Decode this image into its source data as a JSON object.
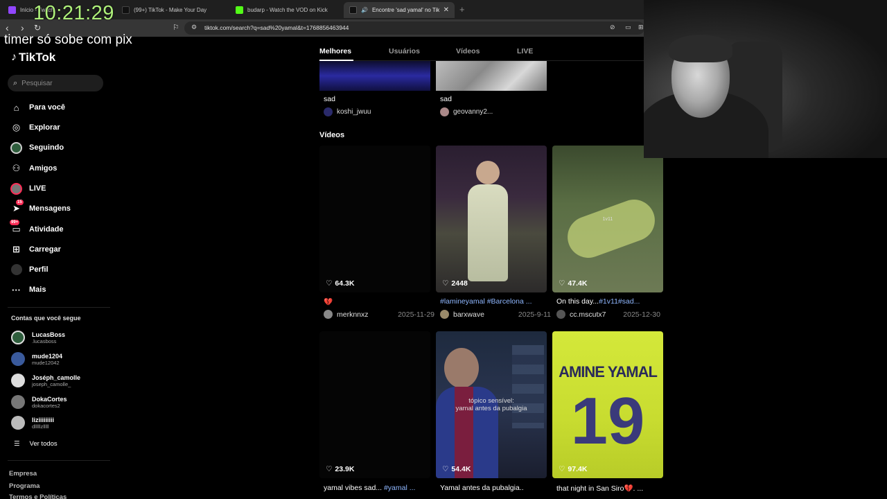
{
  "browser": {
    "tabs": [
      {
        "title": "Início - Twitch",
        "active": false
      },
      {
        "title": "(99+) TikTok - Make Your Day",
        "active": false
      },
      {
        "title": "budarp - Watch the VOD on Kick",
        "active": false
      },
      {
        "title": "Encontre 'sad yamal' no TikTok",
        "active": true
      }
    ],
    "url": "tiktok.com/search?q=sad%20yamal&t=1768856463944"
  },
  "stream": {
    "timer": "10:21:29",
    "overlay_text": "timer só sobe com pix"
  },
  "sidebar": {
    "logo": "TikTok",
    "search_placeholder": "Pesquisar",
    "nav": [
      {
        "label": "Para você",
        "icon": "home-icon"
      },
      {
        "label": "Explorar",
        "icon": "compass-icon"
      },
      {
        "label": "Seguindo",
        "icon": "following-avatar-icon"
      },
      {
        "label": "Amigos",
        "icon": "friends-icon"
      },
      {
        "label": "LIVE",
        "icon": "live-avatar-icon"
      },
      {
        "label": "Mensagens",
        "icon": "paper-plane-icon",
        "badge": "15"
      },
      {
        "label": "Atividade",
        "icon": "inbox-icon",
        "badge": "99+"
      },
      {
        "label": "Carregar",
        "icon": "plus-square-icon"
      },
      {
        "label": "Perfil",
        "icon": "profile-avatar-icon"
      },
      {
        "label": "Mais",
        "icon": "more-icon"
      }
    ],
    "following_title": "Contas que você segue",
    "following": [
      {
        "name": "LucasBoss",
        "handle": ".lucasboss"
      },
      {
        "name": "mude1204",
        "handle": "mude12042"
      },
      {
        "name": "Joséph_camolle",
        "handle": "joseph_camolle_"
      },
      {
        "name": "DokaCortes",
        "handle": "dokacortes2"
      },
      {
        "name": "liziiiiiiiii",
        "handle": "dlllllzlllll"
      }
    ],
    "see_all": "Ver todos",
    "footer": [
      "Empresa",
      "Programa",
      "Termos e Políticas"
    ]
  },
  "main": {
    "tabs": [
      "Melhores",
      "Usuários",
      "Vídeos",
      "LIVE"
    ],
    "active_tab": "Melhores",
    "top_cards": [
      {
        "title": "sad",
        "handle": "koshi_jwuu"
      },
      {
        "title": "sad",
        "handle": "geovanny2..."
      }
    ],
    "videos_title": "Vídeos",
    "videos": [
      {
        "likes": "64.3K",
        "caption_plain": "💔",
        "caption_tag": "",
        "user": "merknnxz",
        "date": "2025-11-29"
      },
      {
        "likes": "2448",
        "caption_plain": "",
        "caption_tag": "#lamineyamal #Barcelona ...",
        "user": "barxwave",
        "date": "2025-9-11"
      },
      {
        "likes": "47.4K",
        "caption_plain": "On this day...",
        "caption_tag": "#1v11#sad...",
        "user": "cc.mscutx7",
        "date": "2025-12-30",
        "overlay": "1v11"
      },
      {
        "likes": "23.9K",
        "caption_plain": "yamal vibes sad... ",
        "caption_tag": "#yamal ...",
        "user": "",
        "date": ""
      },
      {
        "likes": "54.4K",
        "caption_plain": "Yamal antes da pubalgia..",
        "caption_tag": "",
        "user": "",
        "date": "",
        "overlay_line1": "tópico sensível:",
        "overlay_line2": "yamal antes da pubalgia"
      },
      {
        "likes": "97.4K",
        "caption_plain": "that night in San Siro💔. ...",
        "caption_tag": "",
        "user": "",
        "date": "",
        "jersey_name": "AMINE YAMAL",
        "jersey_number": "19"
      }
    ]
  }
}
